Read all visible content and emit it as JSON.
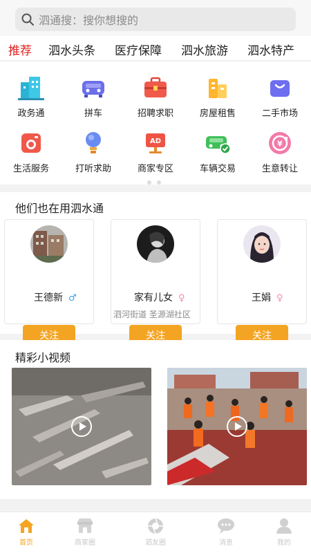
{
  "search": {
    "placeholder": "泗通搜：搜你想搜的"
  },
  "tabs": [
    {
      "label": "推荐",
      "active": true
    },
    {
      "label": "泗水头条"
    },
    {
      "label": "医疗保障"
    },
    {
      "label": "泗水旅游"
    },
    {
      "label": "泗水特产"
    }
  ],
  "services": [
    {
      "label": "政务通",
      "icon": "building-icon"
    },
    {
      "label": "拼车",
      "icon": "car-icon"
    },
    {
      "label": "招聘求职",
      "icon": "briefcase-icon"
    },
    {
      "label": "房屋租售",
      "icon": "buildings-icon"
    },
    {
      "label": "二手市场",
      "icon": "shopping-bag-icon"
    },
    {
      "label": "生活服务",
      "icon": "washing-machine-icon"
    },
    {
      "label": "打听求助",
      "icon": "lightbulb-icon"
    },
    {
      "label": "商家专区",
      "icon": "ad-board-icon"
    },
    {
      "label": "车辆交易",
      "icon": "car-check-icon"
    },
    {
      "label": "生意转让",
      "icon": "exchange-icon"
    }
  ],
  "users_section": {
    "title": "他们也在用泗水通",
    "users": [
      {
        "name": "王德新",
        "gender": "♂",
        "location": "",
        "follow": "关注"
      },
      {
        "name": "家有儿女",
        "gender": "♀",
        "location": "泗河街道 圣源湖社区",
        "follow": "关注"
      },
      {
        "name": "王娟",
        "gender": "♀",
        "location": "",
        "follow": "关注"
      }
    ]
  },
  "videos_section": {
    "title": "精彩小视频"
  },
  "bottom_nav": [
    {
      "label": "首页",
      "icon": "home-icon",
      "active": true
    },
    {
      "label": "商家圈",
      "icon": "shop-icon"
    },
    {
      "label": "泗友圈",
      "icon": "camera-shutter-icon"
    },
    {
      "label": "消息",
      "icon": "chat-icon"
    },
    {
      "label": "我的",
      "icon": "user-icon"
    }
  ],
  "colors": {
    "accent": "#f4a423",
    "active_tab": "#e02020",
    "male": "#3aa0e8",
    "female": "#f08aa8"
  }
}
